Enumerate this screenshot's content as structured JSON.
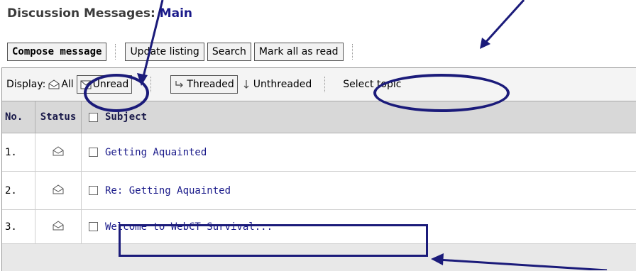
{
  "page": {
    "title_prefix": "Discussion Messages:",
    "title_forum": "Main"
  },
  "toolbar": {
    "compose_label": "Compose message",
    "update_label": "Update listing",
    "search_label": "Search",
    "mark_read_label": "Mark all as read"
  },
  "display": {
    "label": "Display:",
    "all_label": "All",
    "unread_label": "Unread",
    "threaded_label": "Threaded",
    "unthreaded_label": "Unthreaded",
    "select_topic_label": "Select topic"
  },
  "table": {
    "headers": {
      "no": "No.",
      "status": "Status",
      "subject": "Subject"
    },
    "rows": [
      {
        "no": "1.",
        "subject": "Getting Aquainted"
      },
      {
        "no": "2.",
        "subject": "Re: Getting Aquainted"
      },
      {
        "no": "3.",
        "subject": "Welcome to WebCT Survival..."
      }
    ]
  },
  "colors": {
    "annotation": "#1b1b7a",
    "link": "#1a1a8a"
  }
}
